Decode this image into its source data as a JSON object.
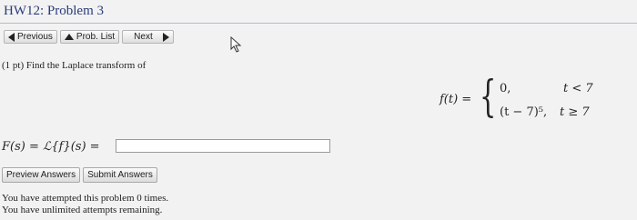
{
  "header": {
    "title": "HW12: Problem 3"
  },
  "nav": {
    "previous_label": "Previous",
    "problem_list_label": "Prob. List",
    "next_label": "Next"
  },
  "problem": {
    "prompt": "(1 pt) Find the Laplace transform of",
    "function_lhs": "f(t) =",
    "case1_value": "0,",
    "case1_condition": "t < 7",
    "case2_value": "(t − 7)⁵,",
    "case2_condition": "t ≥ 7"
  },
  "answer": {
    "label": "F(s) = ℒ{f}(s) =",
    "value": "",
    "placeholder": ""
  },
  "buttons": {
    "preview_label": "Preview Answers",
    "submit_label": "Submit Answers"
  },
  "status": {
    "attempts_line": "You have attempted this problem 0 times.",
    "remaining_line": "You have unlimited attempts remaining."
  },
  "colors": {
    "title": "#2a3b78",
    "page_background": "#f2f2f3"
  },
  "icons": {
    "previous": "triangle-left-icon",
    "problem_list": "triangle-up-icon",
    "next": "triangle-right-icon",
    "cursor": "mouse-pointer-icon"
  }
}
